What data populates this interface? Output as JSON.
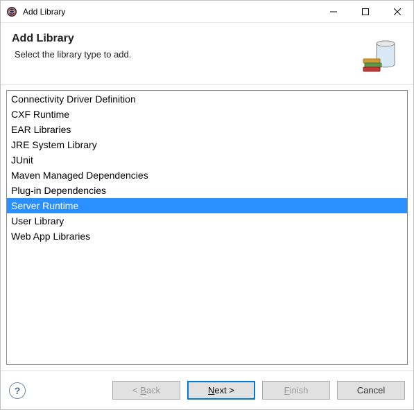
{
  "titlebar": {
    "title": "Add Library"
  },
  "header": {
    "title": "Add Library",
    "subtitle": "Select the library type to add."
  },
  "list": {
    "items": [
      "Connectivity Driver Definition",
      "CXF Runtime",
      "EAR Libraries",
      "JRE System Library",
      "JUnit",
      "Maven Managed Dependencies",
      "Plug-in Dependencies",
      "Server Runtime",
      "User Library",
      "Web App Libraries"
    ],
    "selected_index": 7
  },
  "buttons": {
    "back_prefix": "< ",
    "back_mn": "B",
    "back_suffix": "ack",
    "next_mn": "N",
    "next_suffix": "ext >",
    "finish_prefix": "",
    "finish_mn": "F",
    "finish_suffix": "inish",
    "cancel": "Cancel"
  }
}
